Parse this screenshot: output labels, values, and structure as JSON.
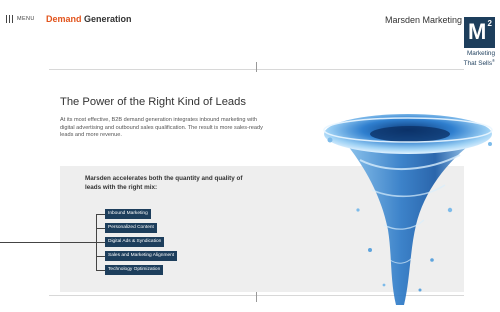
{
  "header": {
    "menu_label": "MENU",
    "title_accent": "Demand",
    "title_rest": " Generation",
    "company_name": "Marsden Marketing",
    "logo_letter": "M",
    "logo_superscript": "2",
    "tagline_line1": "Marketing",
    "tagline_line2": "That Sells",
    "tagline_mark": "®"
  },
  "hero": {
    "headline": "The Power of the Right Kind of Leads",
    "intro": "At its most effective, B2B demand generation integrates inbound marketing with digital advertising and outbound sales qualification. The result is more sales-ready leads and more revenue."
  },
  "mix": {
    "heading": "Marsden accelerates both the quantity and quality of leads with the right mix:",
    "items": [
      "Inbound Marketing",
      "Personalized Content",
      "Digital Ads & Syndication",
      "Sales and Marketing Alignment",
      "Technology Optimization"
    ]
  },
  "colors": {
    "accent": "#e2541c",
    "brand_navy": "#1d3e5c",
    "panel_bg": "#eeeeee",
    "water": "#3a86c8"
  },
  "icons": {
    "menu": "hamburger-vertical-bars-icon",
    "illustration": "water-splash-vortex"
  }
}
